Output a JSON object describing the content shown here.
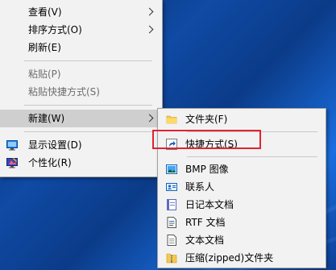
{
  "context_menu": {
    "items": [
      {
        "label": "查看(V)",
        "submenu": true
      },
      {
        "label": "排序方式(O)",
        "submenu": true
      },
      {
        "label": "刷新(E)"
      },
      {
        "label": "粘贴(P)",
        "disabled": true
      },
      {
        "label": "粘贴快捷方式(S)",
        "disabled": true
      },
      {
        "label": "新建(W)",
        "submenu": true,
        "selected": true
      },
      {
        "label": "显示设置(D)",
        "icon": "display-settings-icon"
      },
      {
        "label": "个性化(R)",
        "icon": "personalize-icon"
      }
    ]
  },
  "new_submenu": {
    "items": [
      {
        "label": "文件夹(F)",
        "icon": "folder-icon"
      },
      {
        "label": "快捷方式(S)",
        "icon": "shortcut-icon",
        "highlighted": true
      },
      {
        "label": "BMP 图像",
        "icon": "bmp-image-icon"
      },
      {
        "label": "联系人",
        "icon": "contact-icon"
      },
      {
        "label": "日记本文档",
        "icon": "journal-icon"
      },
      {
        "label": "RTF 文档",
        "icon": "rtf-document-icon"
      },
      {
        "label": "文本文档",
        "icon": "text-document-icon"
      },
      {
        "label": "压缩(zipped)文件夹",
        "icon": "zip-folder-icon"
      }
    ]
  },
  "colors": {
    "highlight_border": "#e0242f",
    "menu_background": "#f2f2f2",
    "selected_background": "#cfcfcf"
  }
}
